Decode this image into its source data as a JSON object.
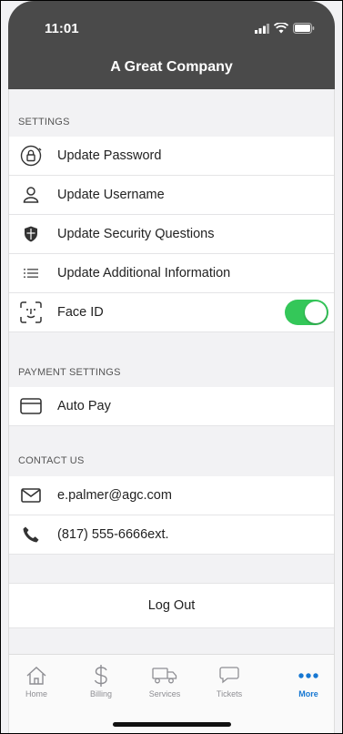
{
  "status_bar": {
    "time": "11:01"
  },
  "header": {
    "title": "A Great Company"
  },
  "settings": {
    "section_label": "SETTINGS",
    "items": [
      {
        "label": "Update Password",
        "icon": "lock-icon"
      },
      {
        "label": "Update Username",
        "icon": "user-icon"
      },
      {
        "label": "Update Security Questions",
        "icon": "shield-icon"
      },
      {
        "label": "Update Additional Information",
        "icon": "list-icon"
      },
      {
        "label": "Face ID",
        "icon": "face-id-icon",
        "toggle_on": true
      }
    ]
  },
  "payment_settings": {
    "section_label": "PAYMENT SETTINGS",
    "items": [
      {
        "label": "Auto Pay",
        "icon": "credit-card-icon"
      }
    ]
  },
  "contact": {
    "section_label": "CONTACT US",
    "email": "e.palmer@agc.com",
    "phone": "(817) 555-6666ext."
  },
  "logout_label": "Log Out",
  "tabs": [
    {
      "label": "Home",
      "icon": "home-icon"
    },
    {
      "label": "Billing",
      "icon": "dollar-icon"
    },
    {
      "label": "Services",
      "icon": "truck-icon"
    },
    {
      "label": "Tickets",
      "icon": "chat-icon"
    },
    {
      "label": "More",
      "icon": "more-icon",
      "active": true
    }
  ],
  "colors": {
    "header_bg": "#4a4a4a",
    "toggle_on": "#34c759",
    "active_tab": "#1677d2"
  }
}
